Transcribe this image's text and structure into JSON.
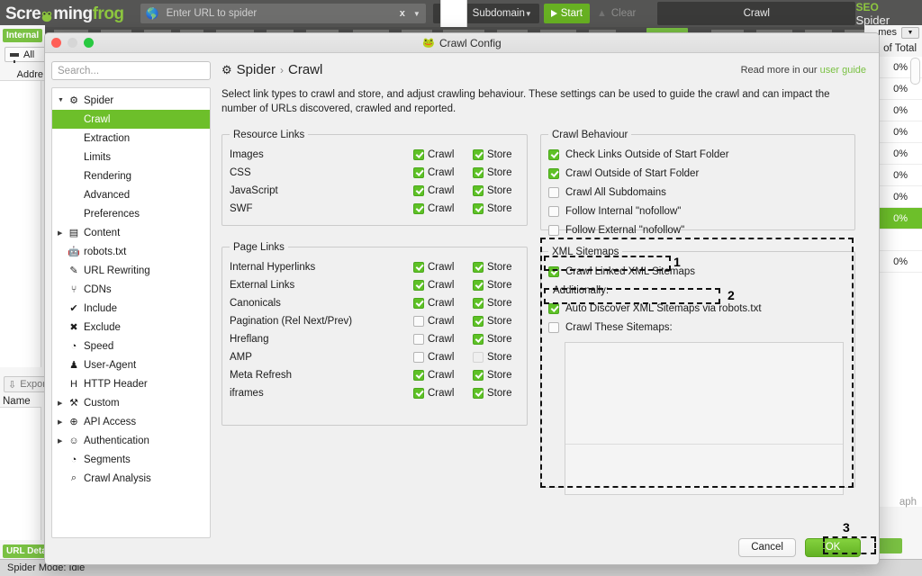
{
  "app": {
    "logo_part1": "Scre",
    "logo_part2": "ming",
    "logo_part3": "frog",
    "url_placeholder": "Enter URL to spider",
    "url_clear": "x",
    "mode_label": "Subdomain",
    "start_label": "Start",
    "clear_label": "Clear",
    "crawl_tab_label": "Crawl",
    "brand_seo": "SEO",
    "brand_spider": "Spider",
    "status": "Spider Mode: Idle"
  },
  "left_panel": {
    "internal_badge": "Internal",
    "filter_label": "All",
    "address_header": "Addre",
    "export_label": "Expor",
    "name_header": "Name",
    "url_details_badge": "URL Deta"
  },
  "right_panel": {
    "header_times": "mes",
    "header_of_total": "of Total",
    "graph_label": "aph",
    "rows": [
      "0%",
      "0%",
      "0%",
      "0%",
      "0%",
      "0%",
      "0%",
      "0%",
      "",
      "0%"
    ],
    "highlight_index": 7
  },
  "dialog": {
    "title": "Crawl Config",
    "search_placeholder": "Search...",
    "breadcrumb": {
      "root": "Spider",
      "separator": "›",
      "current": "Crawl"
    },
    "read_more": "Read more in our",
    "read_more_link": "user guide",
    "intro": "Select link types to crawl and store, and adjust crawling behaviour. These settings can be used to guide the crawl and can impact the number of URLs discovered, crawled and reported.",
    "cancel_label": "Cancel",
    "ok_label": "OK"
  },
  "sidebar": {
    "items": [
      {
        "label": "Spider",
        "icon": "gear-icon",
        "arrow": "▼",
        "level": 1,
        "selected": false
      },
      {
        "label": "Crawl",
        "icon": "",
        "arrow": "",
        "level": 2,
        "selected": true
      },
      {
        "label": "Extraction",
        "icon": "",
        "arrow": "",
        "level": 2,
        "selected": false
      },
      {
        "label": "Limits",
        "icon": "",
        "arrow": "",
        "level": 2,
        "selected": false
      },
      {
        "label": "Rendering",
        "icon": "",
        "arrow": "",
        "level": 2,
        "selected": false
      },
      {
        "label": "Advanced",
        "icon": "",
        "arrow": "",
        "level": 2,
        "selected": false
      },
      {
        "label": "Preferences",
        "icon": "",
        "arrow": "",
        "level": 2,
        "selected": false
      },
      {
        "label": "Content",
        "icon": "columns-icon",
        "arrow": "▶",
        "level": 1,
        "selected": false
      },
      {
        "label": "robots.txt",
        "icon": "robot-icon",
        "arrow": "",
        "level": 1,
        "selected": false
      },
      {
        "label": "URL Rewriting",
        "icon": "pencil-box-icon",
        "arrow": "",
        "level": 1,
        "selected": false
      },
      {
        "label": "CDNs",
        "icon": "network-icon",
        "arrow": "",
        "level": 1,
        "selected": false
      },
      {
        "label": "Include",
        "icon": "check-circle-icon",
        "arrow": "",
        "level": 1,
        "selected": false
      },
      {
        "label": "Exclude",
        "icon": "x-circle-icon",
        "arrow": "",
        "level": 1,
        "selected": false
      },
      {
        "label": "Speed",
        "icon": "gauge-icon",
        "arrow": "",
        "level": 1,
        "selected": false
      },
      {
        "label": "User-Agent",
        "icon": "robot-head-icon",
        "arrow": "",
        "level": 1,
        "selected": false
      },
      {
        "label": "HTTP Header",
        "icon": "letter-h-icon",
        "arrow": "",
        "level": 1,
        "selected": false
      },
      {
        "label": "Custom",
        "icon": "tools-icon",
        "arrow": "▶",
        "level": 1,
        "selected": false
      },
      {
        "label": "API Access",
        "icon": "globe-icon",
        "arrow": "▶",
        "level": 1,
        "selected": false
      },
      {
        "label": "Authentication",
        "icon": "people-icon",
        "arrow": "▶",
        "level": 1,
        "selected": false
      },
      {
        "label": "Segments",
        "icon": "pie-icon",
        "arrow": "",
        "level": 1,
        "selected": false
      },
      {
        "label": "Crawl Analysis",
        "icon": "search-icon",
        "arrow": "",
        "level": 1,
        "selected": false
      }
    ]
  },
  "resource_links": {
    "legend": "Resource Links",
    "crawl_label": "Crawl",
    "store_label": "Store",
    "rows": [
      {
        "name": "Images",
        "crawl": true,
        "store": true
      },
      {
        "name": "CSS",
        "crawl": true,
        "store": true
      },
      {
        "name": "JavaScript",
        "crawl": true,
        "store": true
      },
      {
        "name": "SWF",
        "crawl": true,
        "store": true
      }
    ]
  },
  "page_links": {
    "legend": "Page Links",
    "crawl_label": "Crawl",
    "store_label": "Store",
    "rows": [
      {
        "name": "Internal Hyperlinks",
        "crawl": true,
        "store": true,
        "crawl_dim": false,
        "store_dim": false
      },
      {
        "name": "External Links",
        "crawl": true,
        "store": true,
        "crawl_dim": false,
        "store_dim": false
      },
      {
        "name": "Canonicals",
        "crawl": true,
        "store": true,
        "crawl_dim": false,
        "store_dim": false
      },
      {
        "name": "Pagination (Rel Next/Prev)",
        "crawl": false,
        "store": true,
        "crawl_dim": false,
        "store_dim": false
      },
      {
        "name": "Hreflang",
        "crawl": false,
        "store": true,
        "crawl_dim": false,
        "store_dim": false
      },
      {
        "name": "AMP",
        "crawl": false,
        "store": false,
        "crawl_dim": false,
        "store_dim": true
      },
      {
        "name": "Meta Refresh",
        "crawl": true,
        "store": true,
        "crawl_dim": false,
        "store_dim": false
      },
      {
        "name": "iframes",
        "crawl": true,
        "store": true,
        "crawl_dim": false,
        "store_dim": false
      }
    ]
  },
  "crawl_behaviour": {
    "legend": "Crawl Behaviour",
    "rows": [
      {
        "label": "Check Links Outside of Start Folder",
        "checked": true
      },
      {
        "label": "Crawl Outside of Start Folder",
        "checked": true
      },
      {
        "label": "Crawl All Subdomains",
        "checked": false
      },
      {
        "label": "Follow Internal \"nofollow\"",
        "checked": false
      },
      {
        "label": "Follow External \"nofollow\"",
        "checked": false
      }
    ]
  },
  "xml_sitemaps": {
    "legend": "XML Sitemaps",
    "crawl_linked": {
      "label": "Crawl Linked XML Sitemaps",
      "checked": true
    },
    "additionally_label": "Additionally:",
    "auto_discover": {
      "label": "Auto Discover XML Sitemaps via robots.txt",
      "checked": true
    },
    "crawl_these": {
      "label": "Crawl These Sitemaps:",
      "checked": false
    }
  },
  "annotations": [
    {
      "number": "1"
    },
    {
      "number": "2"
    },
    {
      "number": "3"
    }
  ],
  "colors": {
    "accent_green": "#7ac143",
    "check_green": "#5ec126",
    "topbar": "#555554",
    "selection": "#6dbf2a"
  }
}
